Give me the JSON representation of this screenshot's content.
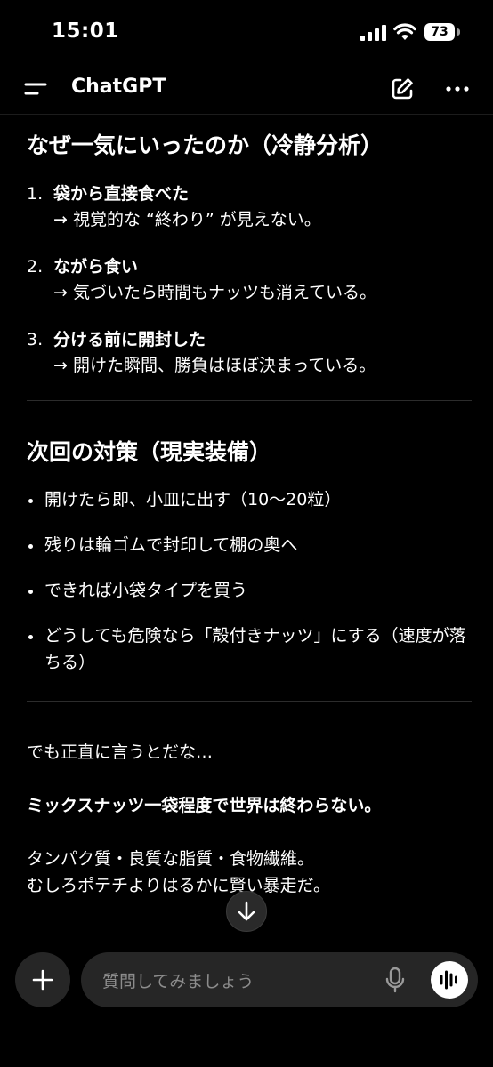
{
  "status_bar": {
    "time": "15:01",
    "battery": "73"
  },
  "header": {
    "title": "ChatGPT",
    "icons": [
      "menu-icon",
      "new-chat-icon",
      "more-icon"
    ]
  },
  "message": {
    "section1": {
      "heading": "なぜ一気にいったのか（冷静分析）",
      "items": [
        {
          "num": "1.",
          "title": "袋から直接食べた",
          "detail": "→ 視覚的な “終わり” が見えない。"
        },
        {
          "num": "2.",
          "title": "ながら食い",
          "detail": "→ 気づいたら時間もナッツも消えている。"
        },
        {
          "num": "3.",
          "title": "分ける前に開封した",
          "detail": "→ 開けた瞬間、勝負はほぼ決まっている。"
        }
      ]
    },
    "section2": {
      "heading": "次回の対策（現実装備）",
      "bullets": [
        "開けたら即、小皿に出す（10〜20粒）",
        "残りは輪ゴムで封印して棚の奥へ",
        "できれば小袋タイプを買う",
        "どうしても危険なら「殻付きナッツ」にする（速度が落ちる）"
      ]
    },
    "paragraphs": [
      "でも正直に言うとだな…",
      "ミックスナッツ一袋程度で世界は終わらない。",
      "タンパク質・良質な脂質・食物繊維。",
      "むしろポテチよりはるかに賢い暴走だ。"
    ]
  },
  "composer": {
    "placeholder": "質問してみましょう"
  },
  "colors": {
    "background": "#000000",
    "input_background": "#262626",
    "placeholder": "#8c8c8c"
  }
}
